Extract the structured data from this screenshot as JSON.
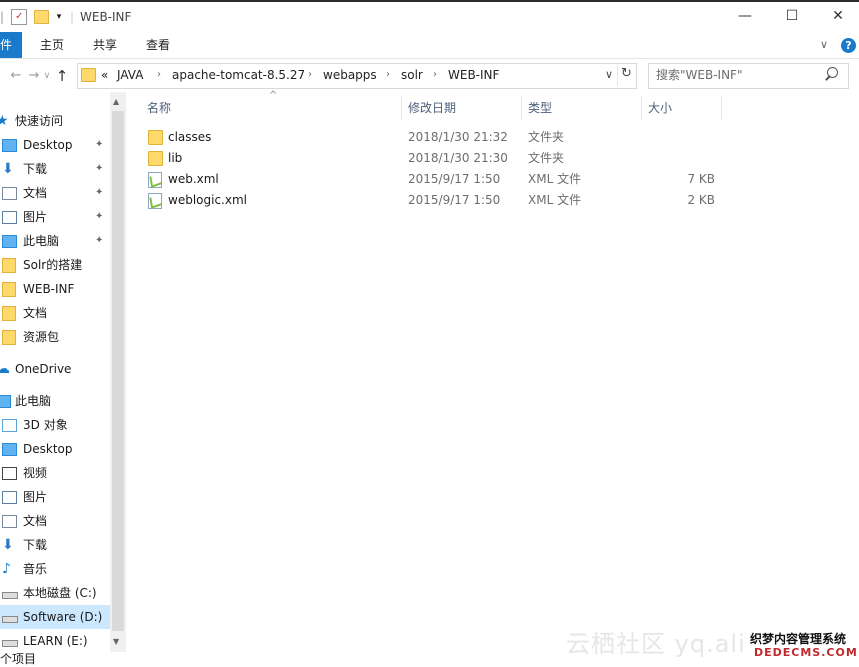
{
  "window": {
    "title": "WEB-INF",
    "minimize": "—",
    "maximize": "☐",
    "close": "✕"
  },
  "ribbon": {
    "file": "件",
    "tabs": [
      "主页",
      "共享",
      "查看"
    ],
    "collapse": "∨",
    "help": "?"
  },
  "address": {
    "overflow": "«",
    "crumbs": [
      "JAVA",
      "apache-tomcat-8.5.27",
      "webapps",
      "solr",
      "WEB-INF"
    ],
    "separator": "›",
    "dropdown": "∨",
    "refresh": "↻"
  },
  "search": {
    "placeholder": "搜索\"WEB-INF\""
  },
  "nav": {
    "back": "←",
    "forward": "→",
    "recent": "∨",
    "up": "↑",
    "items": [
      {
        "label": "快速访问",
        "icon": "star-icon",
        "pinned": false
      },
      {
        "label": "Desktop",
        "icon": "desktop-icon",
        "pinned": true
      },
      {
        "label": "下载",
        "icon": "download-icon",
        "pinned": true
      },
      {
        "label": "文档",
        "icon": "document-icon",
        "pinned": true
      },
      {
        "label": "图片",
        "icon": "picture-icon",
        "pinned": true
      },
      {
        "label": "此电脑",
        "icon": "computer-icon",
        "pinned": true
      },
      {
        "label": "Solr的搭建",
        "icon": "folder-icon",
        "pinned": false
      },
      {
        "label": "WEB-INF",
        "icon": "folder-icon",
        "pinned": false
      },
      {
        "label": "文档",
        "icon": "folder-icon",
        "pinned": false
      },
      {
        "label": "资源包",
        "icon": "folder-icon",
        "pinned": false
      },
      {
        "label": "OneDrive",
        "icon": "cloud-icon",
        "pinned": false
      },
      {
        "label": "此电脑",
        "icon": "computer-icon",
        "pinned": false
      },
      {
        "label": "3D 对象",
        "icon": "cube-icon",
        "pinned": false
      },
      {
        "label": "Desktop",
        "icon": "desktop-icon",
        "pinned": false
      },
      {
        "label": "视频",
        "icon": "video-icon",
        "pinned": false
      },
      {
        "label": "图片",
        "icon": "picture-icon",
        "pinned": false
      },
      {
        "label": "文档",
        "icon": "document-icon",
        "pinned": false
      },
      {
        "label": "下载",
        "icon": "download-icon",
        "pinned": false
      },
      {
        "label": "音乐",
        "icon": "music-icon",
        "pinned": false
      },
      {
        "label": "本地磁盘 (C:)",
        "icon": "drive-icon",
        "pinned": false
      },
      {
        "label": "Software (D:)",
        "icon": "drive-icon",
        "pinned": false,
        "selected": true
      },
      {
        "label": "LEARN (E:)",
        "icon": "drive-icon",
        "pinned": false
      }
    ],
    "pin_glyph": "📌"
  },
  "columns": {
    "name": "名称",
    "date": "修改日期",
    "type": "类型",
    "size": "大小",
    "sort_indicator": "^"
  },
  "files": [
    {
      "name": "classes",
      "date": "2018/1/30 21:32",
      "type": "文件夹",
      "size": "",
      "icon": "folder-icon"
    },
    {
      "name": "lib",
      "date": "2018/1/30 21:30",
      "type": "文件夹",
      "size": "",
      "icon": "folder-icon"
    },
    {
      "name": "web.xml",
      "date": "2015/9/17 1:50",
      "type": "XML 文件",
      "size": "7 KB",
      "icon": "xml-file-icon"
    },
    {
      "name": "weblogic.xml",
      "date": "2015/9/17 1:50",
      "type": "XML 文件",
      "size": "2 KB",
      "icon": "xml-file-icon"
    }
  ],
  "status": {
    "items": "个项目"
  },
  "watermark": {
    "text": "云栖社区 yq.ali",
    "brand_cn": "织梦内容管理系统",
    "brand_en": "DEDECMS.COM"
  }
}
